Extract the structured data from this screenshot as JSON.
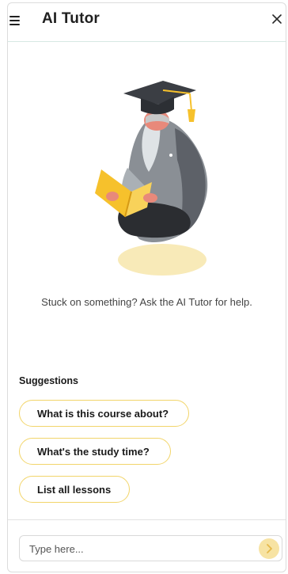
{
  "header": {
    "title": "AI Tutor"
  },
  "main": {
    "intro_text": "Stuck on something? Ask the AI Tutor for help."
  },
  "suggestions": {
    "heading": "Suggestions",
    "items": [
      {
        "label": "What is this course about?"
      },
      {
        "label": "What's the study time?"
      },
      {
        "label": "List all lessons"
      }
    ]
  },
  "composer": {
    "placeholder": "Type here..."
  },
  "colors": {
    "accent_yellow": "#f2d56a",
    "send_button_bg": "#f7e3a3",
    "header_divider": "#d7e8e3"
  },
  "icons": {
    "menu": "hamburger-menu-icon",
    "close": "close-icon",
    "send": "chevron-right-icon",
    "illustration": "graduate-reading-book-illustration"
  }
}
